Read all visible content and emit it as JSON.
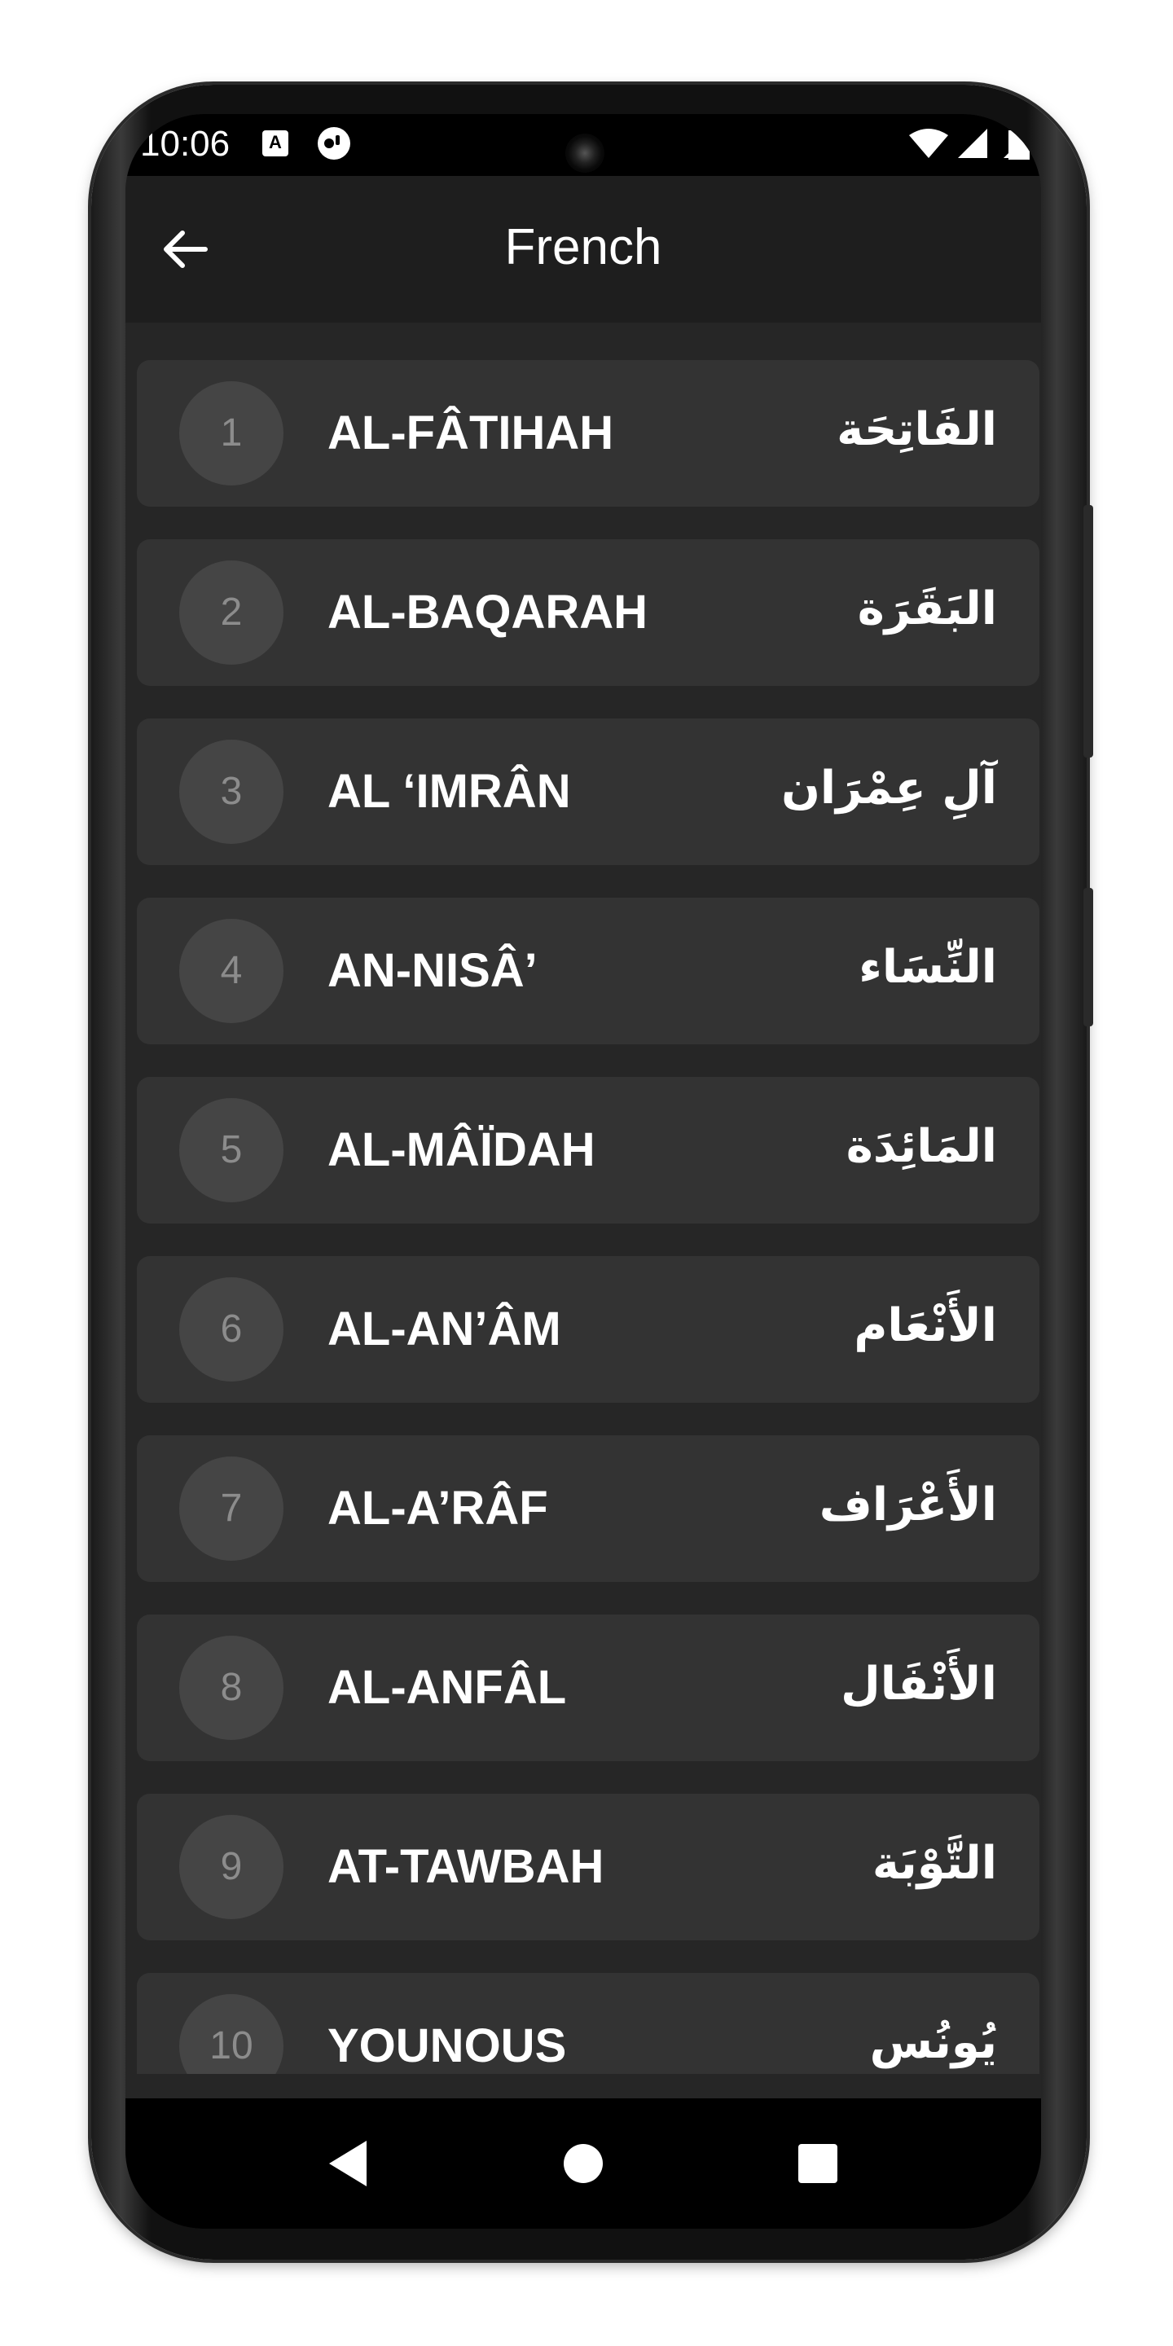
{
  "status_bar": {
    "time": "10:06",
    "notification_icons": [
      "text-badge-icon",
      "record-app-icon"
    ],
    "system_icons": [
      "wifi-icon",
      "signal-icon",
      "battery-icon"
    ]
  },
  "app_bar": {
    "title": "French",
    "back_icon": "arrow-left-icon"
  },
  "surahs": [
    {
      "number": "1",
      "name": "AL-FÂTIHAH",
      "arabic": "الفَاتِحَة"
    },
    {
      "number": "2",
      "name": "AL-BAQARAH",
      "arabic": "البَقَرَة"
    },
    {
      "number": "3",
      "name": "AL ‘IMRÂN",
      "arabic": "آلِ عِمْرَان"
    },
    {
      "number": "4",
      "name": "AN-NISÂ’",
      "arabic": "النِّسَاء"
    },
    {
      "number": "5",
      "name": "AL-MÂÏDAH",
      "arabic": "المَائِدَة"
    },
    {
      "number": "6",
      "name": "AL-AN’ÂM",
      "arabic": "الأَنْعَام"
    },
    {
      "number": "7",
      "name": "AL-A’RÂF",
      "arabic": "الأَعْرَاف"
    },
    {
      "number": "8",
      "name": "AL-ANFÂL",
      "arabic": "الأَنْفَال"
    },
    {
      "number": "9",
      "name": "AT-TAWBAH",
      "arabic": "التَّوْبَة"
    },
    {
      "number": "10",
      "name": "YOUNOUS",
      "arabic": "يُونُس"
    }
  ],
  "nav_bar": {
    "icons": [
      "back-triangle-icon",
      "home-circle-icon",
      "recents-square-icon"
    ]
  },
  "colors": {
    "background": "#262626",
    "card": "#333333",
    "app_bar": "#1e1e1e",
    "number_circle": "#454545",
    "number_text": "#8c8c8c",
    "text": "#ffffff"
  }
}
